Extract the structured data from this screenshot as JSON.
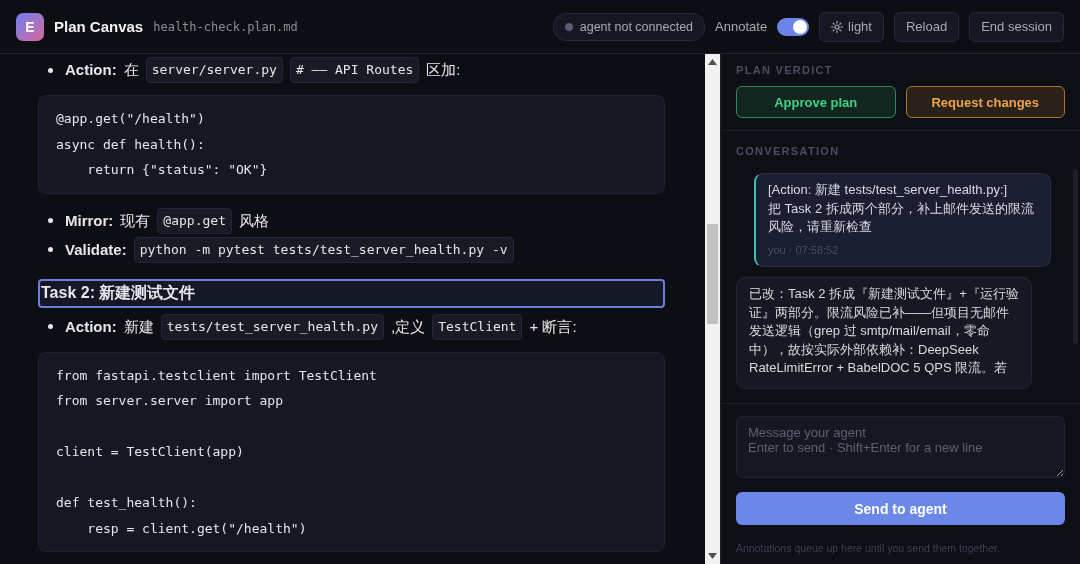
{
  "header": {
    "logo": "E",
    "title": "Plan Canvas",
    "file": "health-check.plan.md",
    "status": {
      "text": "agent not connected",
      "connected": false
    },
    "annotate": {
      "label": "Annotate",
      "on": true
    },
    "buttons": [
      {
        "kind": "theme",
        "label": "light"
      },
      {
        "kind": "plain",
        "label": "Reload"
      },
      {
        "kind": "plain",
        "label": "End session"
      }
    ]
  },
  "document": [
    {
      "kind": "bullet",
      "label": "Action:",
      "segments": [
        {
          "kind": "text",
          "text": "在"
        },
        {
          "kind": "code",
          "text": "server/server.py"
        },
        {
          "kind": "code",
          "text": "# —— API Routes"
        },
        {
          "kind": "text",
          "text": "区加:"
        }
      ]
    },
    {
      "kind": "code_block",
      "lines": [
        {
          "kind": "line",
          "text": "@app.get(\"/health\")"
        },
        {
          "kind": "line",
          "text": "async def health():"
        },
        {
          "kind": "line",
          "text": "    return {\"status\": \"OK\"}"
        }
      ]
    },
    {
      "kind": "bullet",
      "label": "Mirror:",
      "segments": [
        {
          "kind": "text",
          "text": "现有"
        },
        {
          "kind": "code",
          "text": "@app.get"
        },
        {
          "kind": "text",
          "text": "风格"
        }
      ]
    },
    {
      "kind": "bullet",
      "label": "Validate:",
      "segments": [
        {
          "kind": "code",
          "text": "python -m pytest tests/test_server_health.py -v"
        }
      ]
    },
    {
      "kind": "heading",
      "text": "Task 2: 新建测试文件",
      "selected": true
    },
    {
      "kind": "bullet",
      "label": "Action:",
      "segments": [
        {
          "kind": "text",
          "text": "新建"
        },
        {
          "kind": "code",
          "text": "tests/test_server_health.py"
        },
        {
          "kind": "text",
          "text": ",定义"
        },
        {
          "kind": "code",
          "text": "TestClient"
        },
        {
          "kind": "text",
          "text": "+ 断言:"
        }
      ]
    },
    {
      "kind": "code_block",
      "lines": [
        {
          "kind": "line",
          "text": "from fastapi.testclient import TestClient"
        },
        {
          "kind": "line",
          "text": "from server.server import app"
        },
        {
          "kind": "blank"
        },
        {
          "kind": "line",
          "text": "client = TestClient(app)"
        },
        {
          "kind": "blank"
        },
        {
          "kind": "line",
          "text": "def test_health():"
        },
        {
          "kind": "line",
          "text": "    resp = client.get(\"/health\")"
        }
      ]
    }
  ],
  "sidebar": {
    "verdict_title": "PLAN VERDICT",
    "verdict_buttons": [
      {
        "kind": "approve",
        "label": "Approve plan"
      },
      {
        "kind": "request",
        "label": "Request changes"
      }
    ],
    "conversation_title": "CONVERSATION",
    "messages": [
      {
        "kind": "user",
        "text": "[Action: 新建 tests/test_server_health.py:]\n把 Task 2 拆成两个部分，补上邮件发送的限流风险，请重新检查",
        "meta": "you · 07:58:52"
      },
      {
        "kind": "agent",
        "text": "已改：Task 2 拆成『新建测试文件』+『运行验证』两部分。限流风险已补——但项目无邮件发送逻辑（grep 过 smtp/mail/email，零命中），故按实际外部依赖补：DeepSeek RateLimitError + BabelDOC 5 QPS 限流。若"
      }
    ],
    "composer": {
      "placeholder": "Message your agent\nEnter to send · Shift+Enter for a new line"
    },
    "send_label": "Send to agent",
    "footnote": "Annotations queue up here until you send them together."
  }
}
